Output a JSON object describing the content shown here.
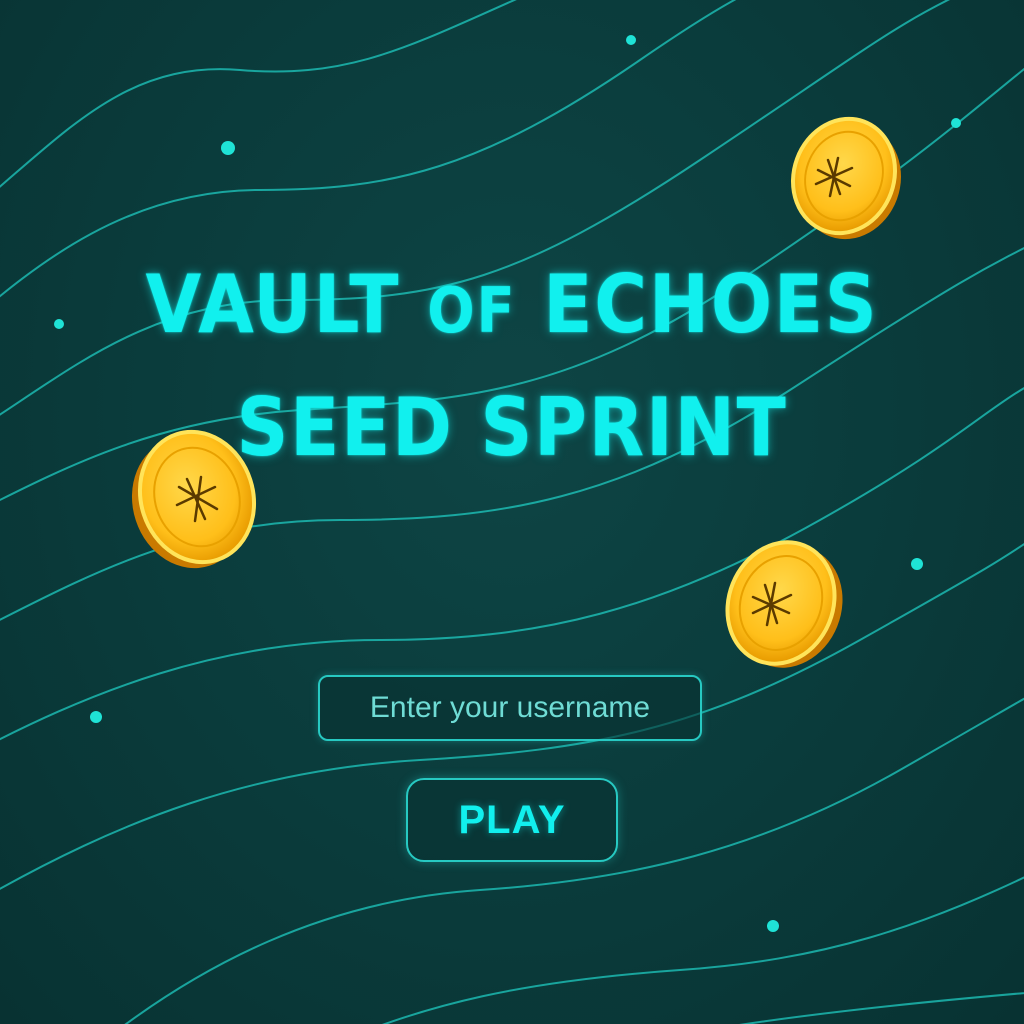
{
  "title": {
    "line1_part1": "VAULT ",
    "line1_part2": "OF",
    "line1_part3": " ECHOES",
    "line2": "SEED SPRINT"
  },
  "username_input": {
    "placeholder": "Enter your username",
    "value": ""
  },
  "play_button": {
    "label": "PLAY"
  },
  "decorations": {
    "coin_icon": "asterisk-coin-icon",
    "coin_count": 3
  },
  "colors": {
    "background": "#0a3b3b",
    "accent": "#11f0ee",
    "line": "#1fc9c0",
    "coin": "#ffc20e"
  }
}
